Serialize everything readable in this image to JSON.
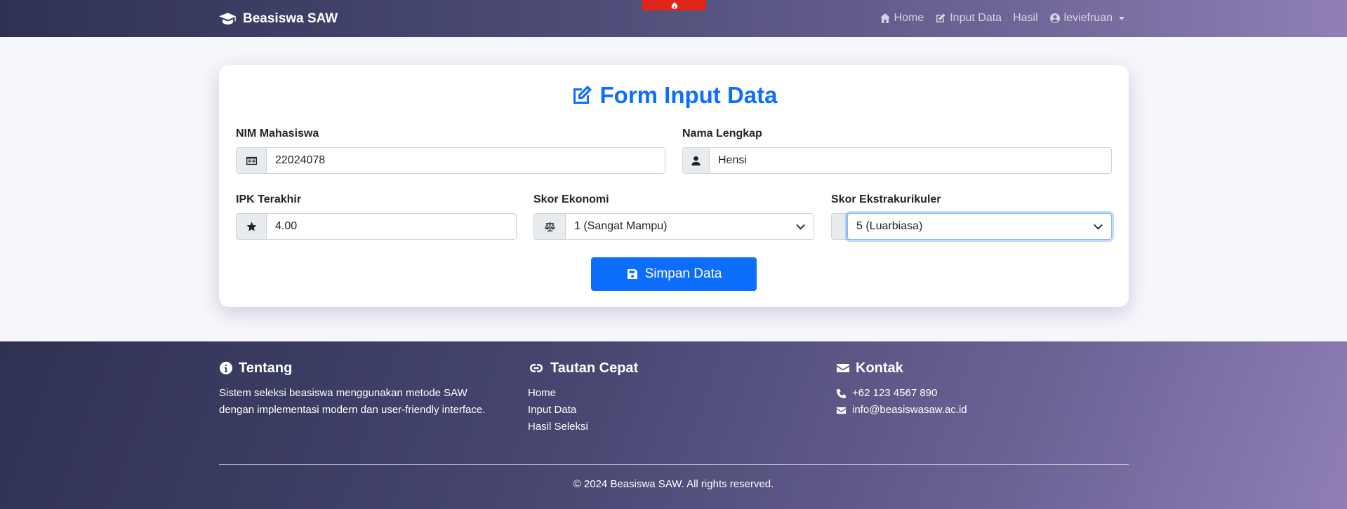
{
  "navbar": {
    "brand": "Beasiswa SAW",
    "links": [
      {
        "label": "Home",
        "icon": "home-icon"
      },
      {
        "label": "Input Data",
        "icon": "edit-icon"
      },
      {
        "label": "Hasil",
        "icon": ""
      },
      {
        "label": "leviefruan",
        "icon": "user-circle-icon"
      }
    ]
  },
  "form": {
    "title": "Form Input Data",
    "nim": {
      "label": "NIM Mahasiswa",
      "value": "22024078",
      "icon": "id-card-icon"
    },
    "nama": {
      "label": "Nama Lengkap",
      "value": "Hensi",
      "icon": "user-icon"
    },
    "ipk": {
      "label": "IPK Terakhir",
      "value": "4.00",
      "icon": "star-icon"
    },
    "ekonomi": {
      "label": "Skor Ekonomi",
      "value": "1 (Sangat Mampu)",
      "icon": "balance-scale-icon"
    },
    "ekstra": {
      "label": "Skor Ekstrakurikuler",
      "value": "5 (Luarbiasa)"
    },
    "submit_label": "Simpan Data"
  },
  "footer": {
    "about": {
      "heading": "Tentang",
      "text_line1": "Sistem seleksi beasiswa menggunakan metode SAW",
      "text_line2": "dengan implementasi modern dan user-friendly interface."
    },
    "links": {
      "heading": "Tautan Cepat",
      "items": [
        "Home",
        "Input Data",
        "Hasil Seleksi"
      ]
    },
    "contact": {
      "heading": "Kontak",
      "phone": "+62 123 4567 890",
      "email": "info@beasiswasaw.ac.id"
    },
    "copyright": "© 2024 Beasiswa SAW. All rights reserved."
  },
  "colors": {
    "primary": "#0d6efd",
    "banner_red": "#e0261b"
  }
}
